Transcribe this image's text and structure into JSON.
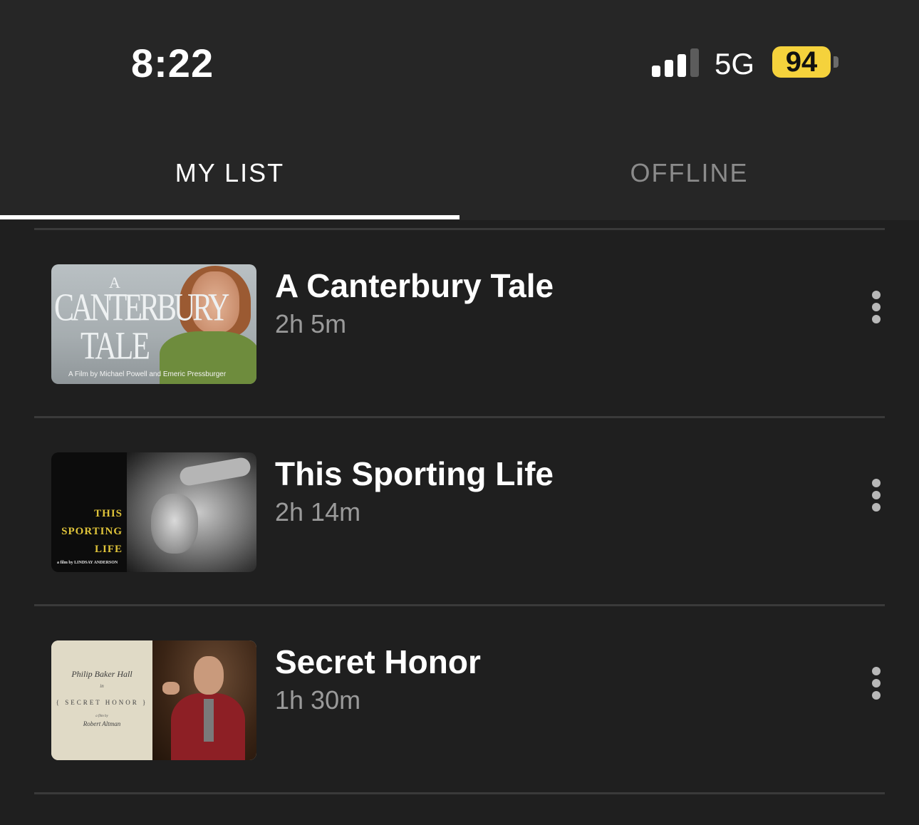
{
  "status_bar": {
    "time": "8:22",
    "network": "5G",
    "battery": "94",
    "signal_bars_active": 3,
    "signal_bars_total": 4,
    "battery_color": "#f5d23c"
  },
  "tabs": [
    {
      "label": "MY LIST",
      "active": true
    },
    {
      "label": "OFFLINE",
      "active": false
    }
  ],
  "items": [
    {
      "title": "A Canterbury Tale",
      "duration": "2h 5m",
      "poster": {
        "word_a": "A",
        "word_canterbury": "CANTERBURY",
        "word_tale": "TALE",
        "credit": "A Film by Michael Powell and Emeric Pressburger"
      }
    },
    {
      "title": "This Sporting Life",
      "duration": "2h 14m",
      "poster": {
        "line1": "THIS",
        "line2": "SPORTING",
        "line3": "LIFE",
        "credit": "a film by LINDSAY ANDERSON"
      }
    },
    {
      "title": "Secret Honor",
      "duration": "1h 30m",
      "poster": {
        "line1": "Philip Baker Hall",
        "line2": "in",
        "line3": "{ SECRET HONOR }",
        "line4": "a film by",
        "line5": "Robert Altman"
      }
    }
  ],
  "icons": {
    "more": "more-vertical-icon",
    "signal": "cellular-signal-icon",
    "battery": "battery-icon"
  }
}
